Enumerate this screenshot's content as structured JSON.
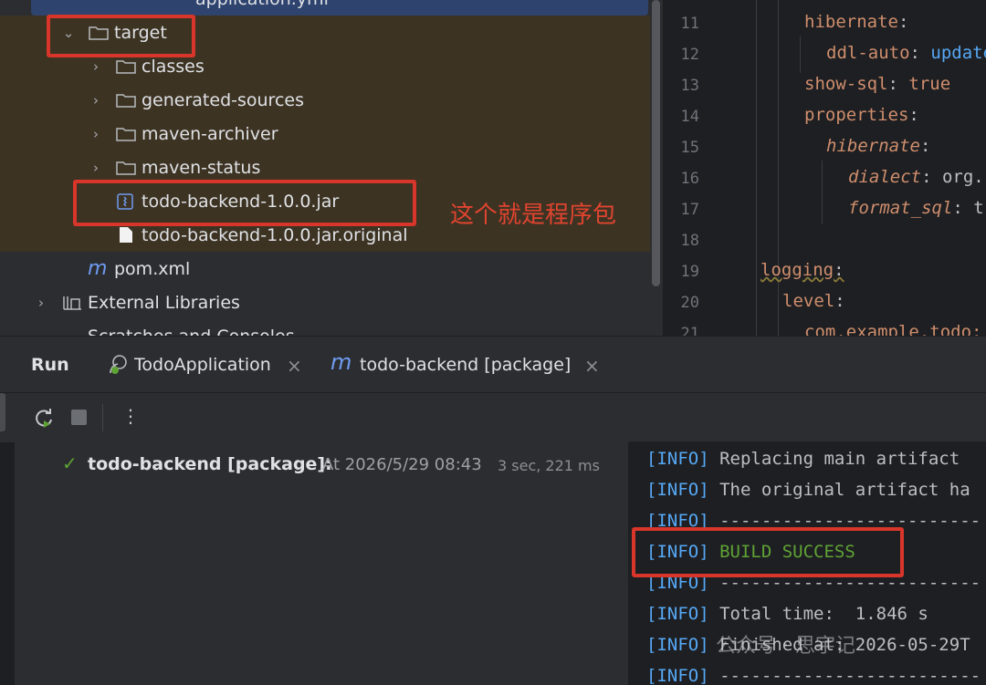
{
  "tree": {
    "top_partial": "application.yml",
    "items": [
      {
        "label": "target",
        "chev": "⌄"
      },
      {
        "label": "classes",
        "chev": "›"
      },
      {
        "label": "generated-sources",
        "chev": "›"
      },
      {
        "label": "maven-archiver",
        "chev": "›"
      },
      {
        "label": "maven-status",
        "chev": "›"
      },
      {
        "label": "todo-backend-1.0.0.jar"
      },
      {
        "label": "todo-backend-1.0.0.jar.original"
      },
      {
        "label": "pom.xml"
      },
      {
        "label": "External Libraries",
        "chev": "›"
      },
      {
        "label": "Scratches and Consoles"
      }
    ],
    "annotation": "这个就是程序包"
  },
  "editor": {
    "line_numbers": [
      "11",
      "12",
      "13",
      "14",
      "15",
      "16",
      "17",
      "18",
      "19",
      "20",
      "21"
    ]
  },
  "run": {
    "title": "Run",
    "tabs": [
      {
        "label": "TodoApplication",
        "close": "×"
      },
      {
        "label": "todo-backend [package]",
        "close": "×"
      }
    ],
    "result": {
      "name": "todo-backend [package]:",
      "detail": "At 2026/5/29 08:43",
      "duration": "3 sec, 221 ms"
    }
  },
  "console": {
    "tag": "[INFO]",
    "lines": [
      "Replacing main artifact",
      "The original artifact ha",
      "-------------------------",
      "BUILD SUCCESS",
      "-------------------------",
      "Total time:  1.846 s",
      "Finished at: 2026-05-29T",
      "-------------------------"
    ]
  },
  "watermark": "公众号 · 思宇记",
  "colors": {
    "accent": "#56a8f5",
    "success": "#5fa335",
    "highlight": "#d8362a"
  }
}
